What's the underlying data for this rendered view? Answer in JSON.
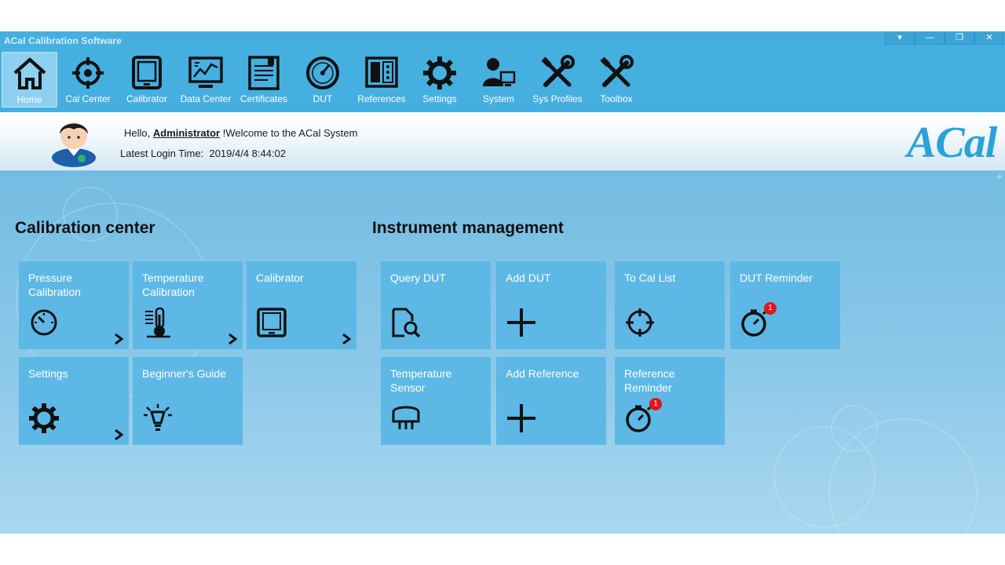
{
  "window": {
    "title": "ACal Calibration Software",
    "controls": {
      "menu": "▾",
      "minimize": "—",
      "restore": "❐",
      "close": "✕"
    }
  },
  "toolbar": [
    {
      "label": "Home",
      "icon": "home-icon",
      "active": true
    },
    {
      "label": "Cal Center",
      "icon": "crosshair-icon"
    },
    {
      "label": "Calibrator",
      "icon": "tablet-icon"
    },
    {
      "label": "Data Center",
      "icon": "chart-monitor-icon"
    },
    {
      "label": "Certificates",
      "icon": "certificate-icon"
    },
    {
      "label": "DUT",
      "icon": "gauge-icon"
    },
    {
      "label": "References",
      "icon": "rack-icon"
    },
    {
      "label": "Settings",
      "icon": "gear-icon"
    },
    {
      "label": "System",
      "icon": "user-computer-icon"
    },
    {
      "label": "Sys Profiles",
      "icon": "tools-icon"
    },
    {
      "label": "Toolbox",
      "icon": "tools-icon"
    }
  ],
  "welcome": {
    "hello_prefix": "Hello, ",
    "user": "Administrator",
    "hello_suffix": " !Welcome to the ACal System",
    "login_label": "Latest Login Time:",
    "login_time": "2019/4/4 8:44:02",
    "logo": "ACal"
  },
  "calibration_center": {
    "title": "Calibration center",
    "tiles": [
      {
        "label": "Pressure Calibration",
        "icon": "gauge-icon",
        "arrow": true
      },
      {
        "label": "Temperature Calibration",
        "icon": "thermometer-icon",
        "arrow": true
      },
      {
        "label": "Calibrator",
        "icon": "tablet-icon",
        "arrow": true
      },
      {
        "label": "Settings",
        "icon": "gear-icon",
        "arrow": true
      },
      {
        "label": "Beginner's Guide",
        "icon": "lightbulb-icon",
        "arrow": false
      }
    ]
  },
  "instrument_management": {
    "title": "Instrument management",
    "tiles": [
      {
        "label": "Query DUT",
        "icon": "document-search-icon"
      },
      {
        "label": "Add DUT",
        "icon": "plus-icon"
      },
      {
        "label": "To Cal List",
        "icon": "crosshair-icon"
      },
      {
        "label": "DUT Reminder",
        "icon": "stopwatch-icon",
        "badge": "1"
      },
      {
        "label": "Temperature Sensor",
        "icon": "sensor-icon"
      },
      {
        "label": "Add Reference",
        "icon": "plus-icon"
      },
      {
        "label": "Reference Reminder",
        "icon": "stopwatch-icon",
        "badge": "1"
      }
    ]
  },
  "colors": {
    "toolbar_bg": "#45afe0",
    "tile_bg": "#5db8e5",
    "badge": "#e2151b",
    "logo": "#2aa2d8"
  }
}
